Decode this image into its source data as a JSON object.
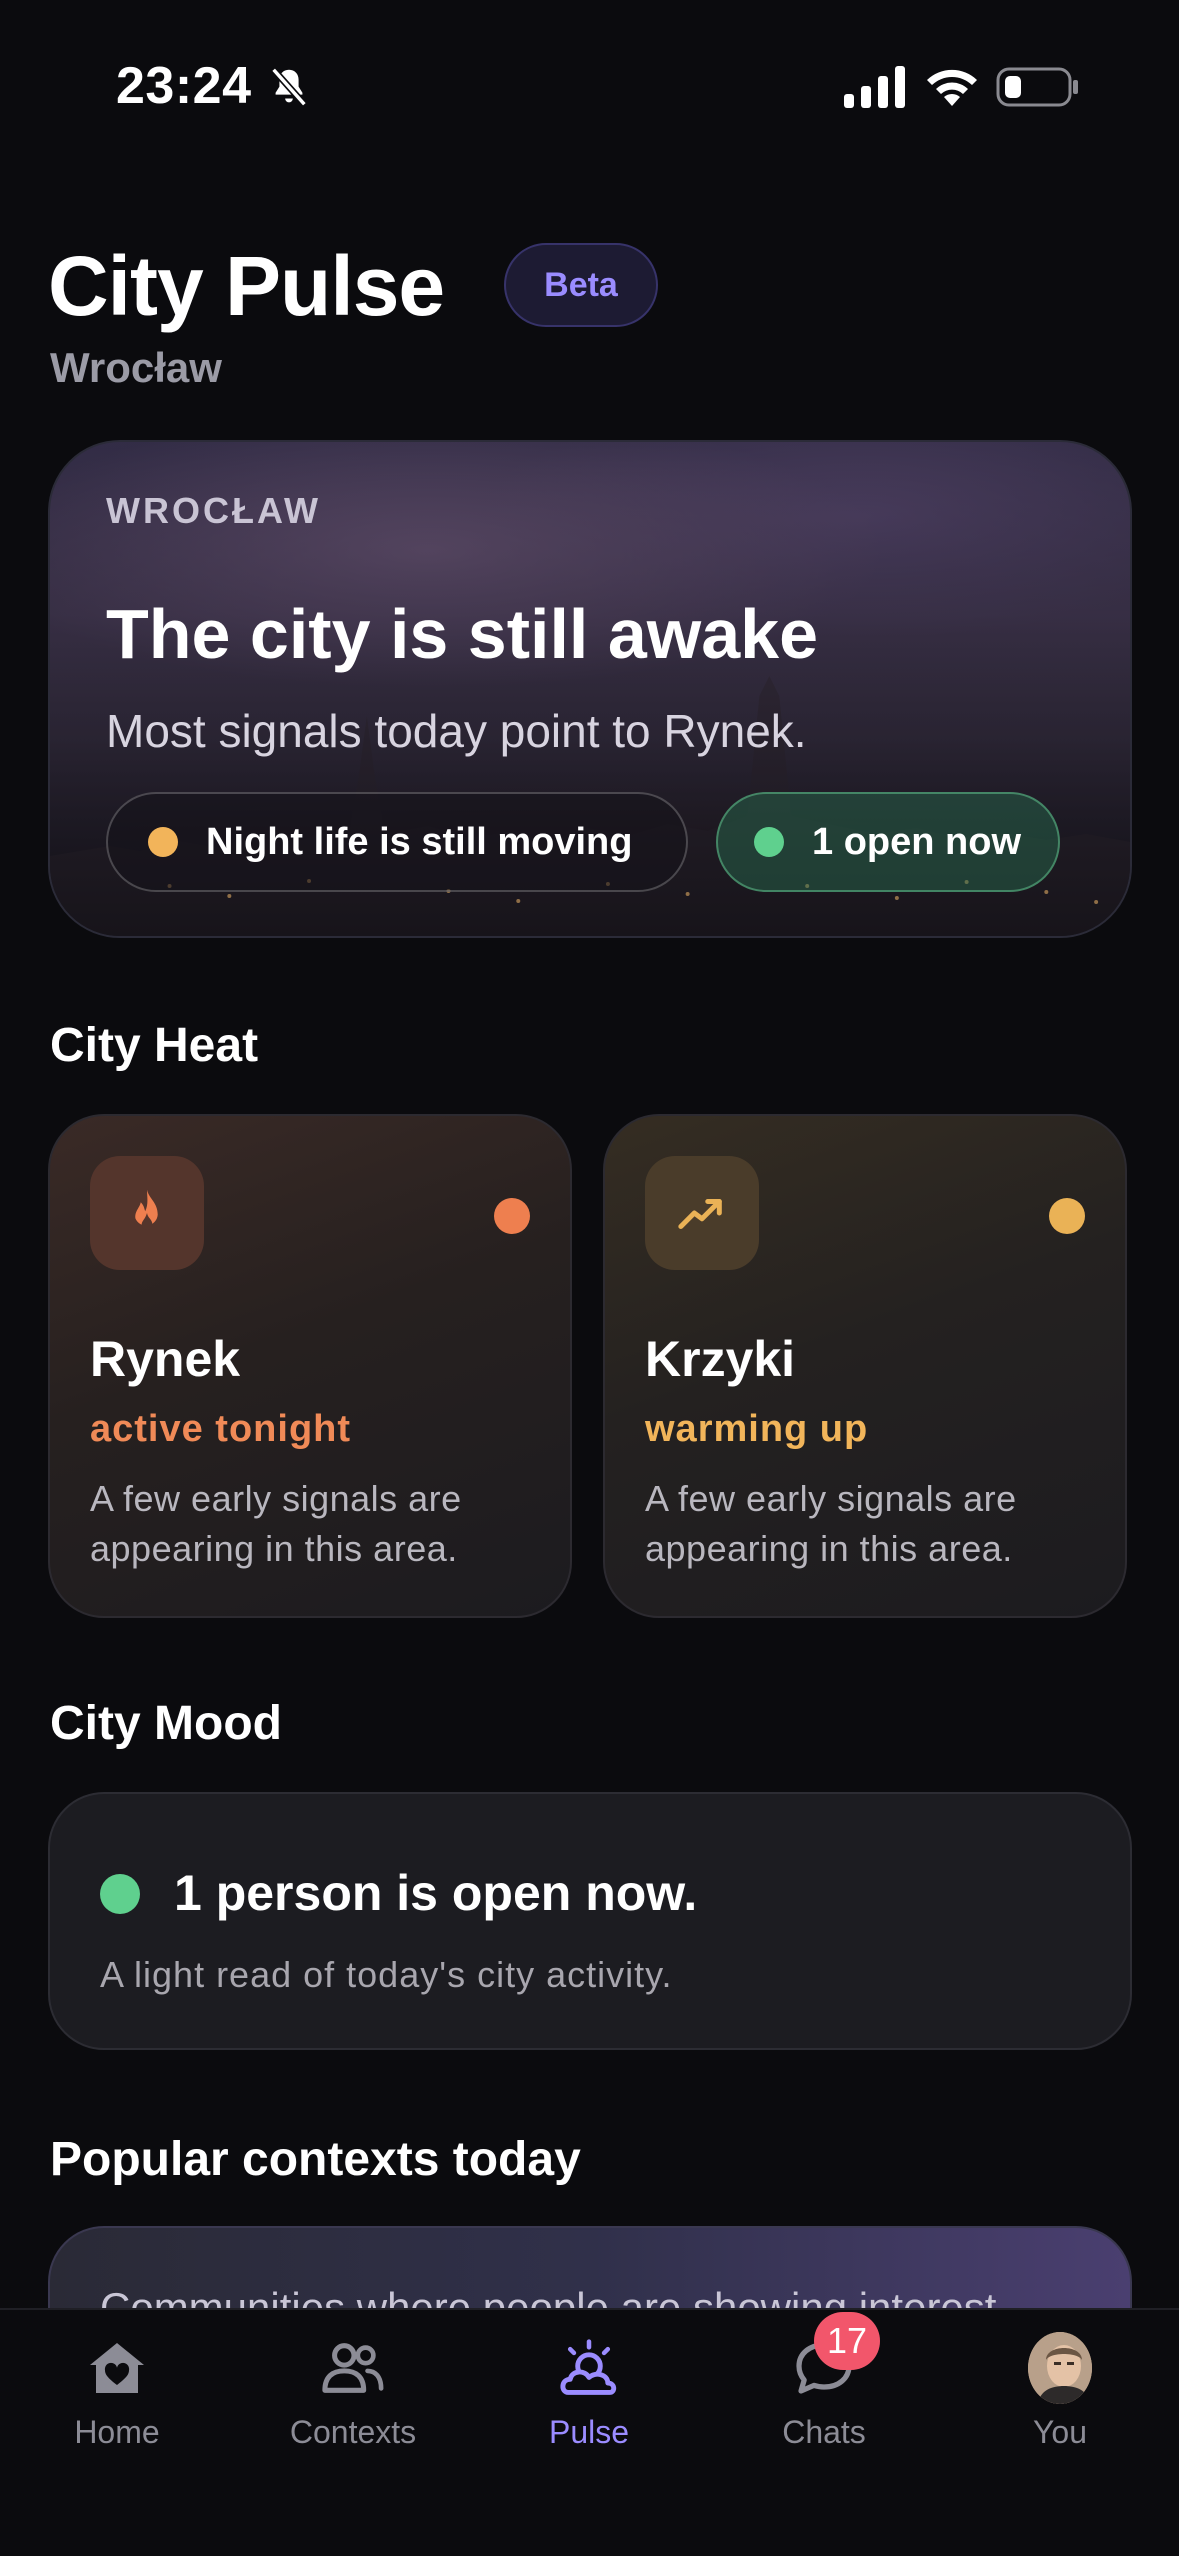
{
  "status_bar": {
    "time": "23:24",
    "icons": [
      "bell-slash-icon",
      "signal-icon",
      "wifi-icon",
      "battery-icon"
    ],
    "battery_level": 0.2
  },
  "header": {
    "title": "City Pulse",
    "badge": "Beta",
    "city": "Wrocław"
  },
  "hero": {
    "eyebrow": "WROCŁAW",
    "title": "The city is still awake",
    "subtitle": "Most signals today point to Rynek.",
    "chips": [
      {
        "label": "Night life is still moving",
        "dot_color": "#f2b45a"
      },
      {
        "label": "1 open now",
        "dot_color": "#5fd08e"
      }
    ]
  },
  "city_heat": {
    "heading": "City Heat",
    "cards": [
      {
        "name": "Rynek",
        "status": "active tonight",
        "status_color": "#f08a57",
        "description": "A few early signals are appearing in this area.",
        "icon": "flame-icon",
        "dot_color": "#ee7f4f"
      },
      {
        "name": "Krzyki",
        "status": "warming up",
        "status_color": "#f2b55a",
        "description": "A few early signals are appearing in this area.",
        "icon": "trending-up-icon",
        "dot_color": "#eab256"
      }
    ]
  },
  "city_mood": {
    "heading": "City Mood",
    "title": "1 person is open now.",
    "description": "A light read of today's city activity.",
    "dot_color": "#5fd08e"
  },
  "popular": {
    "heading": "Popular contexts today",
    "description": "Communities where people are showing interest"
  },
  "tab_bar": {
    "tabs": [
      {
        "label": "Home",
        "icon": "home-heart-icon",
        "active": false
      },
      {
        "label": "Contexts",
        "icon": "people-icon",
        "active": false
      },
      {
        "label": "Pulse",
        "icon": "weather-pulse-icon",
        "active": true
      },
      {
        "label": "Chats",
        "icon": "chat-bubble-icon",
        "active": false
      },
      {
        "label": "You",
        "icon": "avatar",
        "active": false
      }
    ],
    "chats_badge": "17"
  },
  "colors": {
    "accent": "#9b8cff",
    "background": "#0b0b0e"
  }
}
